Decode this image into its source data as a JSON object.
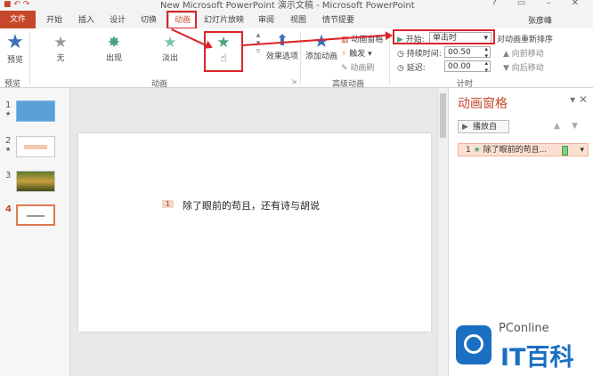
{
  "window": {
    "title": "New Microsoft PowerPoint 演示文稿 - Microsoft PowerPoint",
    "controls": "? ▭ – ✕"
  },
  "tabs": {
    "file": "文件",
    "items": [
      "开始",
      "插入",
      "设计",
      "切换",
      "动画",
      "幻灯片放映",
      "审阅",
      "视图",
      "情节提要"
    ],
    "active": "动画",
    "user": "张彦峰"
  },
  "ribbon": {
    "preview_label": "预览",
    "preview_group": "预览",
    "effects": [
      "无",
      "出现",
      "淡出"
    ],
    "animation_group": "动画",
    "effect_options": "效果选项",
    "add_animation": "添加动画",
    "animation_pane_btn": "动画窗格",
    "trigger": "触发 ▾",
    "animation_painter": "动画刷",
    "advanced_group": "高级动画",
    "start_label": "开始:",
    "start_value": "单击时",
    "duration_label": "持续时间:",
    "duration_value": "00.50",
    "delay_label": "延迟:",
    "delay_value": "00.00",
    "reorder_title": "对动画重新排序",
    "move_earlier": "向前移动",
    "move_later": "向后移动",
    "timing_group": "计时"
  },
  "thumbnails": [
    "1",
    "2",
    "3",
    "4"
  ],
  "slide": {
    "anim_tag": "1",
    "text": "除了眼前的苟且，还有诗与胡说"
  },
  "pane": {
    "title": "动画窗格",
    "close": "▾ ✕",
    "play": "播放自",
    "item_num": "1",
    "item_text": "除了眼前的苟且..."
  },
  "watermark": {
    "brand": "PConline",
    "name": "IT百科"
  },
  "colors": {
    "accent": "#c6482a",
    "highlight_red": "#d8262a",
    "star_green": "#4aa37c",
    "brand_blue": "#1a6fc2"
  }
}
